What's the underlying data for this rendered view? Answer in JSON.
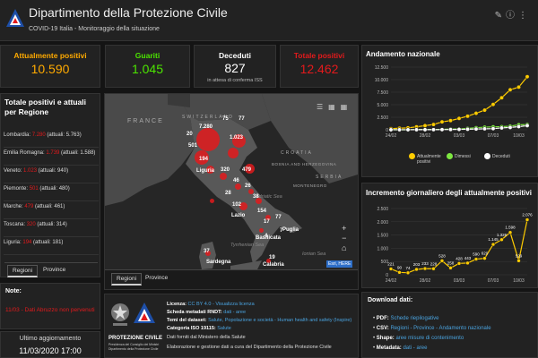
{
  "header": {
    "title": "Dipartimento della Protezione Civile",
    "subtitle": "COVID-19 Italia - Monitoraggio della situazione"
  },
  "stats": {
    "active": {
      "title": "Attualmente positivi",
      "value": "10.590",
      "color": "#ffaa00"
    },
    "healed": {
      "title": "Guariti",
      "value": "1.045",
      "color": "#4ce600"
    },
    "deceased": {
      "title": "Deceduti",
      "value": "827",
      "note": "in attesa di conferma ISS",
      "color": "#ffffff"
    },
    "total": {
      "title": "Totale positivi",
      "value": "12.462",
      "color": "#e31a1c"
    }
  },
  "regions_panel": {
    "heading": "Totale positivi e attuali per Regione",
    "items": [
      {
        "name": "Lombardia:",
        "total": "7.280",
        "active": "(attuali: 5.763)"
      },
      {
        "name": "Emilia Romagna:",
        "total": "1.739",
        "active": "(attuali: 1.588)"
      },
      {
        "name": "Veneto:",
        "total": "1.023",
        "active": "(attuali: 940)"
      },
      {
        "name": "Piemonte:",
        "total": "501",
        "active": "(attuali: 480)"
      },
      {
        "name": "Marche:",
        "total": "479",
        "active": "(attuali: 461)"
      },
      {
        "name": "Toscana:",
        "total": "320",
        "active": "(attuali: 314)"
      },
      {
        "name": "Liguria:",
        "total": "194",
        "active": "(attuali: 181)"
      }
    ],
    "tabs": [
      "Regioni",
      "Province"
    ]
  },
  "note": {
    "heading": "Note:",
    "text": "11/03 - Dati Abruzzo non pervenuti"
  },
  "update": {
    "label": "Ultimo aggiornamento",
    "value": "11/03/2020 17:00"
  },
  "map": {
    "countries": [
      "FRANCE",
      "SWITZERLAND",
      "CROATIA",
      "BOSNIA AND HERZEGOVINA",
      "SERBIA",
      "MONTENEGRO"
    ],
    "seas": [
      "Adriatic Sea",
      "Tyrrhenian Sea",
      "Ionian Sea"
    ],
    "cities": [
      "Liguria",
      "Lazio",
      "Puglia",
      "Basilicata",
      "Sardegna",
      "Calabria"
    ],
    "numbers": [
      "7.280",
      "75",
      "77",
      "20",
      "501",
      "1.023",
      "194",
      "479",
      "320",
      "46",
      "26",
      "38",
      "28",
      "102",
      "154",
      "17",
      "77",
      "7",
      "4",
      "37",
      "19"
    ],
    "attribution": "Esri, HERE",
    "tabs": [
      "Regioni",
      "Province"
    ]
  },
  "national_chart": {
    "title": "Andamento nazionale",
    "legend": [
      "Attualmente positivi",
      "Dimessi",
      "Deceduti"
    ],
    "colors": {
      "active": "#ffcc00",
      "healed": "#7ee841",
      "deceased": "#ffffff"
    }
  },
  "daily_chart": {
    "title": "Incremento giornaliero degli attualmente positivi"
  },
  "chart_data": [
    {
      "type": "line",
      "title": "Andamento nazionale",
      "x": [
        "24/02",
        "25/02",
        "26/02",
        "27/02",
        "28/02",
        "29/02",
        "01/03",
        "02/03",
        "03/03",
        "04/03",
        "05/03",
        "06/03",
        "07/03",
        "08/03",
        "09/03",
        "10/03",
        "11/03"
      ],
      "xticks": [
        "24/02",
        "28/02",
        "03/03",
        "07/03",
        "10/03"
      ],
      "yticks": [
        "0",
        "2.500",
        "5.000",
        "7.500",
        "10.000",
        "12.500"
      ],
      "ylim": [
        0,
        12500
      ],
      "series": [
        {
          "name": "Attualmente positivi",
          "values": [
            221,
            311,
            385,
            588,
            821,
            1049,
            1577,
            1835,
            2263,
            2706,
            3296,
            3916,
            5061,
            6387,
            7985,
            8514,
            10590
          ]
        },
        {
          "name": "Dimessi",
          "values": [
            1,
            1,
            3,
            45,
            46,
            50,
            83,
            149,
            160,
            276,
            414,
            523,
            589,
            622,
            724,
            1004,
            1045
          ]
        },
        {
          "name": "Deceduti",
          "values": [
            7,
            10,
            12,
            17,
            21,
            29,
            34,
            52,
            79,
            107,
            148,
            197,
            233,
            366,
            463,
            631,
            827
          ]
        }
      ]
    },
    {
      "type": "line",
      "title": "Incremento giornaliero degli attualmente positivi",
      "x": [
        "24/02",
        "25/02",
        "26/02",
        "27/02",
        "28/02",
        "29/02",
        "01/03",
        "02/03",
        "03/03",
        "04/03",
        "05/03",
        "06/03",
        "07/03",
        "08/03",
        "09/03",
        "10/03",
        "11/03"
      ],
      "xticks": [
        "24/02",
        "28/02",
        "03/03",
        "07/03",
        "10/03"
      ],
      "yticks": [
        "0",
        "500",
        "1.000",
        "1.500",
        "2.000",
        "2.500"
      ],
      "ylim": [
        0,
        2500
      ],
      "values": [
        221,
        90,
        74,
        203,
        233,
        228,
        528,
        258,
        428,
        443,
        590,
        620,
        1145,
        1326,
        1598,
        529,
        2076
      ],
      "labels": [
        "221",
        "90",
        "74",
        "203",
        "233",
        "228",
        "528",
        "258",
        "428",
        "443",
        "590",
        "620",
        "1.145",
        "1.326",
        "1.598",
        "529",
        "2.076"
      ]
    }
  ],
  "bottom": {
    "logo_title": "PROTEZIONE CIVILE",
    "logo_sub": "Presidenza del Consiglio dei Ministri Dipartimento della Protezione Civile",
    "license_label": "Licenza:",
    "license_value": "CC BY 4.0 - Visualizza licenza",
    "rndt_label": "Scheda metadati RNDT:",
    "rndt_value": "dati - aree",
    "themes_label": "Temi del dataset:",
    "themes_value": "Salute, Popolazione e società - Human health and safety (Inspire)",
    "iso_label": "Categoria ISO 19115:",
    "iso_value": "Salute",
    "source": "Dati forniti dal Ministero della Salute",
    "credit": "Elaborazione e gestione dati a cura del Dipartimento della Protezione Civile"
  },
  "downloads": {
    "heading": "Download dati:",
    "items": [
      {
        "key": "PDF:",
        "value": "Schede riepilogative"
      },
      {
        "key": "CSV:",
        "value": "Regioni - Province - Andamento nazionale"
      },
      {
        "key": "Shape:",
        "value": "aree misure di contenimento"
      },
      {
        "key": "Metadata:",
        "value": "dati - aree"
      }
    ]
  }
}
